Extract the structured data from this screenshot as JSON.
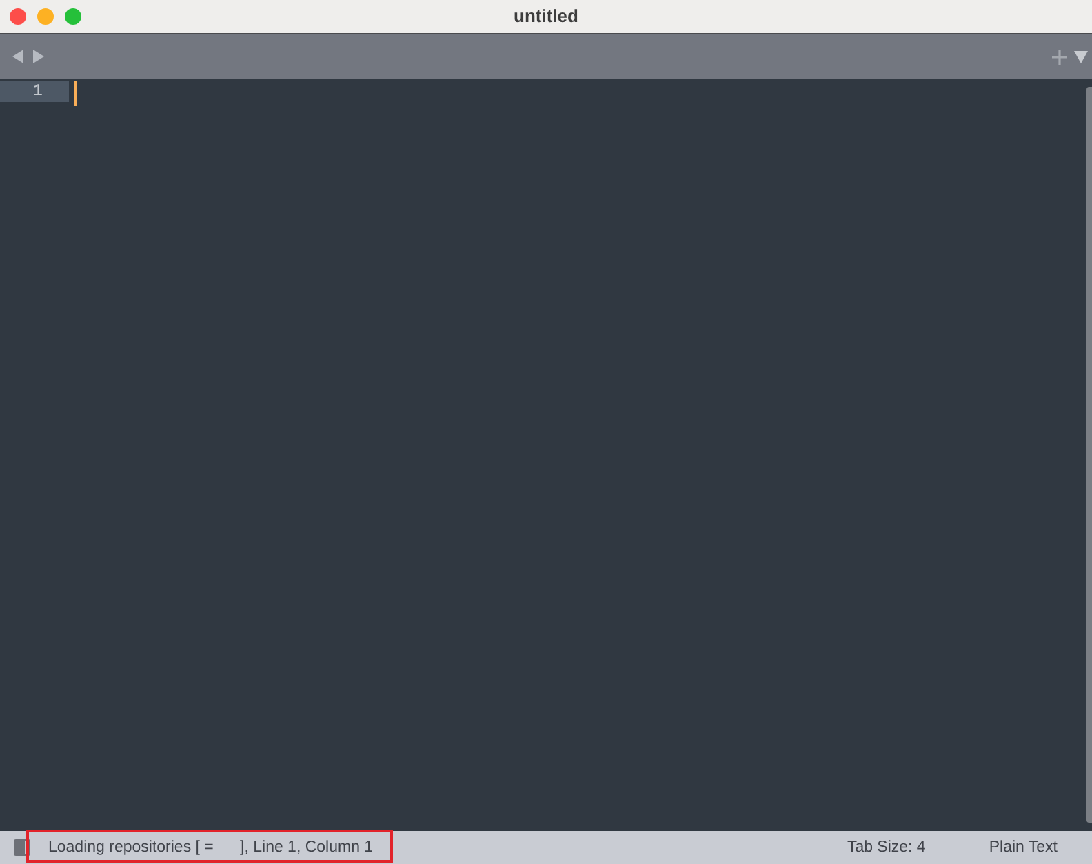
{
  "window": {
    "title": "untitled"
  },
  "editor": {
    "lines": [
      {
        "number": "1",
        "current": true
      }
    ]
  },
  "status_bar": {
    "message": "Loading repositories [ =      ], Line 1, Column 1",
    "highlighted": true,
    "tab_size": "Tab Size: 4",
    "syntax": "Plain Text"
  }
}
